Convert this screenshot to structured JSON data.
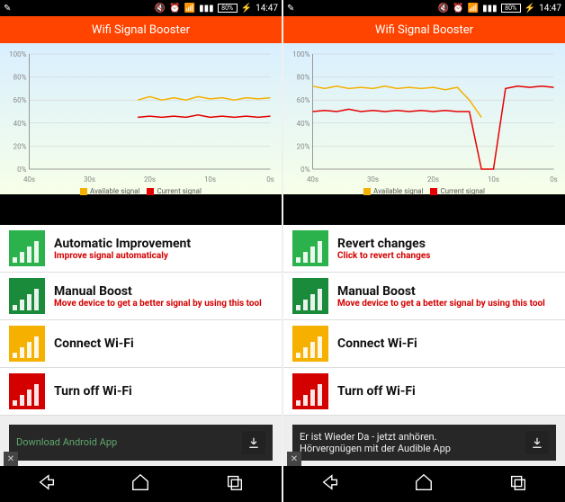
{
  "status": {
    "battery": "80%",
    "time": "14:47"
  },
  "app": {
    "title": "Wifi Signal Booster"
  },
  "chart_data": [
    {
      "type": "line",
      "title": "",
      "xlabel": "",
      "ylabel": "",
      "ylim": [
        0,
        100
      ],
      "x_ticks": [
        "40s",
        "30s",
        "20s",
        "10s",
        "0s"
      ],
      "y_ticks": [
        "0%",
        "20%",
        "40%",
        "60%",
        "80%",
        "100%"
      ],
      "series": [
        {
          "name": "Available signal",
          "color": "#f5b000",
          "x": [
            40,
            38,
            36,
            34,
            32,
            30,
            28,
            26,
            24,
            22,
            20,
            18,
            16,
            14,
            12,
            10,
            8,
            6,
            4,
            2,
            0
          ],
          "values": [
            null,
            null,
            null,
            null,
            null,
            null,
            null,
            null,
            null,
            60,
            63,
            60,
            62,
            60,
            63,
            61,
            62,
            60,
            62,
            61,
            62
          ]
        },
        {
          "name": "Current signal",
          "color": "#e60000",
          "x": [
            40,
            38,
            36,
            34,
            32,
            30,
            28,
            26,
            24,
            22,
            20,
            18,
            16,
            14,
            12,
            10,
            8,
            6,
            4,
            2,
            0
          ],
          "values": [
            null,
            null,
            null,
            null,
            null,
            null,
            null,
            null,
            null,
            45,
            46,
            45,
            46,
            45,
            47,
            45,
            46,
            45,
            46,
            45,
            46
          ]
        }
      ]
    },
    {
      "type": "line",
      "title": "",
      "xlabel": "",
      "ylabel": "",
      "ylim": [
        0,
        100
      ],
      "x_ticks": [
        "40s",
        "30s",
        "20s",
        "10s",
        "0s"
      ],
      "y_ticks": [
        "0%",
        "20%",
        "40%",
        "60%",
        "80%",
        "100%"
      ],
      "series": [
        {
          "name": "Available signal",
          "color": "#f5b000",
          "x": [
            40,
            38,
            36,
            34,
            32,
            30,
            28,
            26,
            24,
            22,
            20,
            18,
            16,
            14,
            12,
            10,
            8,
            6,
            4,
            2,
            0
          ],
          "values": [
            72,
            70,
            72,
            70,
            71,
            70,
            72,
            70,
            71,
            70,
            71,
            69,
            71,
            60,
            45,
            null,
            null,
            null,
            null,
            null,
            null
          ]
        },
        {
          "name": "Current signal",
          "color": "#e60000",
          "x": [
            40,
            38,
            36,
            34,
            32,
            30,
            28,
            26,
            24,
            22,
            20,
            18,
            16,
            14,
            12,
            10,
            8,
            6,
            4,
            2,
            0
          ],
          "values": [
            50,
            51,
            50,
            52,
            50,
            51,
            50,
            51,
            50,
            51,
            50,
            51,
            50,
            50,
            0,
            0,
            70,
            72,
            71,
            72,
            71
          ]
        }
      ]
    }
  ],
  "legend": {
    "available": "Available signal",
    "current": "Current signal"
  },
  "colors": {
    "accent": "#ff4400",
    "green": "#2bb24c",
    "green_dark": "#1a8a3b",
    "yellow": "#f5b000",
    "red": "#d40000"
  },
  "screens": [
    {
      "menu": [
        {
          "icon": "auto",
          "title": "Automatic Improvement",
          "sub": "Improve signal automaticaly"
        },
        {
          "icon": "manual",
          "title": "Manual Boost",
          "sub": "Move device to get a better signal by using this tool"
        },
        {
          "icon": "connect",
          "title": "Connect Wi-Fi",
          "sub": ""
        },
        {
          "icon": "off",
          "title": "Turn off Wi-Fi",
          "sub": ""
        }
      ],
      "ad": {
        "text": "Download Android App",
        "text2": "",
        "color": "#5fa86f"
      }
    },
    {
      "menu": [
        {
          "icon": "auto",
          "title": "Revert changes",
          "sub": "Click to revert changes"
        },
        {
          "icon": "manual",
          "title": "Manual Boost",
          "sub": "Move device to get a better signal by using this tool"
        },
        {
          "icon": "connect",
          "title": "Connect Wi-Fi",
          "sub": ""
        },
        {
          "icon": "off",
          "title": "Turn off Wi-Fi",
          "sub": ""
        }
      ],
      "ad": {
        "text": "Er ist Wieder Da - jetzt anhören.",
        "text2": "Hörvergnügen mit der Audible App",
        "color": "#eee"
      }
    }
  ]
}
